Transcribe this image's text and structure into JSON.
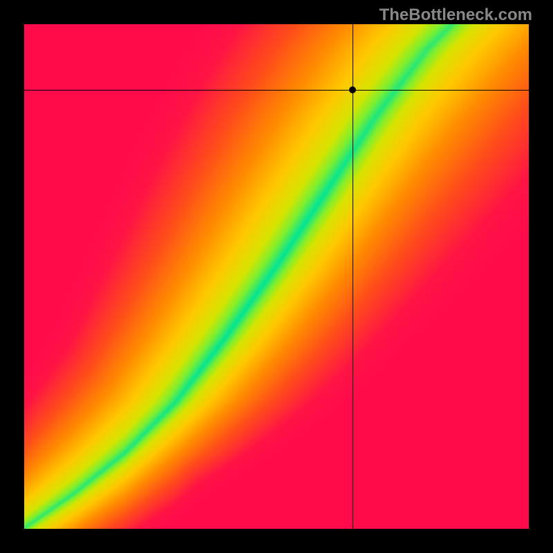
{
  "watermark": "TheBottleneck.com",
  "chart_data": {
    "type": "heatmap",
    "title": "",
    "xlabel": "",
    "ylabel": "",
    "xlim": [
      0,
      1
    ],
    "ylim": [
      0,
      1
    ],
    "marker": {
      "x": 0.65,
      "y": 0.87
    },
    "optimal_curve": [
      {
        "x": 0.0,
        "y": 0.0
      },
      {
        "x": 0.1,
        "y": 0.07
      },
      {
        "x": 0.2,
        "y": 0.15
      },
      {
        "x": 0.3,
        "y": 0.25
      },
      {
        "x": 0.4,
        "y": 0.38
      },
      {
        "x": 0.5,
        "y": 0.52
      },
      {
        "x": 0.6,
        "y": 0.67
      },
      {
        "x": 0.7,
        "y": 0.82
      },
      {
        "x": 0.8,
        "y": 0.95
      },
      {
        "x": 0.85,
        "y": 1.0
      }
    ],
    "color_scale": [
      {
        "distance": 0.0,
        "color": "#00E596"
      },
      {
        "distance": 0.05,
        "color": "#7FEF2E"
      },
      {
        "distance": 0.1,
        "color": "#D6E400"
      },
      {
        "distance": 0.2,
        "color": "#FFC800"
      },
      {
        "distance": 0.35,
        "color": "#FF8C00"
      },
      {
        "distance": 0.55,
        "color": "#FF4D1A"
      },
      {
        "distance": 0.8,
        "color": "#FF1444"
      },
      {
        "distance": 1.0,
        "color": "#FF0B4C"
      }
    ],
    "grid": false,
    "legend": false
  }
}
